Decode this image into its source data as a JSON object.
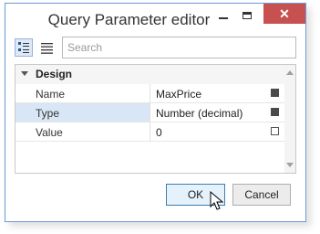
{
  "window": {
    "title": "Query Parameter editor"
  },
  "toolbar": {
    "search_placeholder": "Search"
  },
  "grid": {
    "category": "Design",
    "rows": [
      {
        "name": "Name",
        "value": "MaxPrice"
      },
      {
        "name": "Type",
        "value": "Number (decimal)"
      },
      {
        "name": "Value",
        "value": "0"
      }
    ]
  },
  "buttons": {
    "ok": "OK",
    "cancel": "Cancel"
  },
  "colors": {
    "close_button": "#c75050",
    "selection": "#d9e6f5",
    "window_border": "#6a9bd8"
  }
}
